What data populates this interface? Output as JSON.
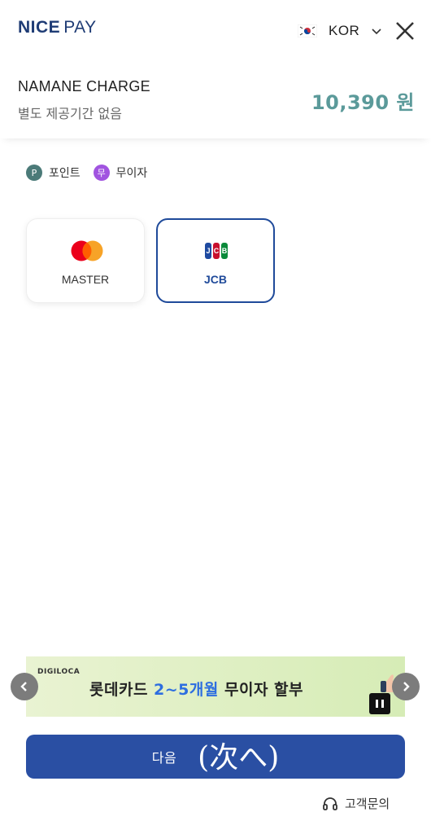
{
  "header": {
    "logo_nice": "NICE",
    "logo_pay": "PAY",
    "language": "KOR"
  },
  "order": {
    "product_name": "NAMANE CHARGE",
    "period": "별도 제공기간 없음",
    "amount": "10,390 원"
  },
  "legend": {
    "point_badge": "P",
    "point_label": "포인트",
    "interest_free_badge": "무",
    "interest_free_label": "무이자"
  },
  "cards": [
    {
      "name": "MASTER",
      "selected": false
    },
    {
      "name": "JCB",
      "selected": true
    }
  ],
  "jcb_logo": [
    "J",
    "C",
    "B"
  ],
  "banner": {
    "brand": "DIGILOCA",
    "text_prefix": "롯데카드",
    "text_highlight": "2~5개월",
    "text_suffix": "무이자 할부"
  },
  "next_button": {
    "label": "다음",
    "annotation": "(次へ)"
  },
  "support": {
    "label": "고객문의"
  },
  "colors": {
    "brand": "#1f3c75",
    "primary_button": "#2a4fa3",
    "amount": "#5b9a9a",
    "point_badge": "#4b7a78",
    "interest_free_badge": "#a154e0"
  }
}
